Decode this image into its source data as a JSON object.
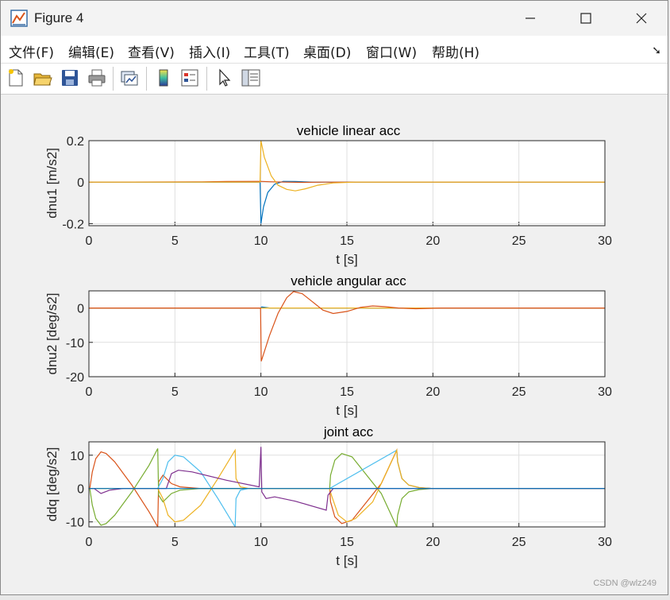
{
  "window": {
    "title": "Figure 4"
  },
  "menu": [
    "文件(F)",
    "编辑(E)",
    "查看(V)",
    "插入(I)",
    "工具(T)",
    "桌面(D)",
    "窗口(W)",
    "帮助(H)"
  ],
  "toolbar_icons": [
    "new-figure-icon",
    "open-file-icon",
    "save-icon",
    "print-icon",
    "link-plot-icon",
    "colorbar-icon",
    "legend-icon",
    "edit-plot-pointer-icon",
    "property-inspector-icon"
  ],
  "watermark": "CSDN @wlz249",
  "colors": {
    "blue": "#0072bd",
    "orange": "#d95319",
    "yellow": "#edb120",
    "purple": "#7e2f8e",
    "green": "#77ac30",
    "cyan": "#4dbeee"
  },
  "chart_data": [
    {
      "type": "line",
      "title": "vehicle linear acc",
      "xlabel": "t [s]",
      "ylabel": "dnu1 [m/s2]",
      "xlim": [
        0,
        30
      ],
      "ylim": [
        -0.21,
        0.2
      ],
      "xticks": [
        "0",
        "5",
        "10",
        "15",
        "20",
        "25",
        "30"
      ],
      "yticks": [
        "-0.2",
        "0",
        "0.2"
      ],
      "grid": true,
      "series": [
        {
          "color": "#0072bd",
          "x": [
            0,
            9.95,
            10.0,
            10.15,
            10.4,
            10.8,
            11.3,
            12.0,
            13.0,
            30
          ],
          "y": [
            0,
            0,
            -0.2,
            -0.12,
            -0.05,
            -0.01,
            0.004,
            0.003,
            0,
            0
          ]
        },
        {
          "color": "#d95319",
          "x": [
            0,
            6.2,
            8.0,
            9.95,
            10.5,
            11.5,
            12.5,
            13.5,
            30
          ],
          "y": [
            0,
            0.001,
            0.003,
            0.004,
            0.002,
            0.0,
            -0.001,
            0,
            0
          ]
        },
        {
          "color": "#edb120",
          "x": [
            0,
            9.95,
            10.0,
            10.2,
            10.6,
            11.0,
            11.5,
            12.0,
            12.6,
            13.3,
            14.2,
            15.5,
            30
          ],
          "y": [
            0,
            0,
            0.2,
            0.12,
            0.03,
            -0.015,
            -0.035,
            -0.042,
            -0.032,
            -0.015,
            -0.004,
            0,
            0
          ]
        }
      ]
    },
    {
      "type": "line",
      "title": "vehicle angular acc",
      "xlabel": "t [s]",
      "ylabel": "dnu2 [deg/s2]",
      "xlim": [
        0,
        30
      ],
      "ylim": [
        -20,
        5
      ],
      "xticks": [
        "0",
        "5",
        "10",
        "15",
        "20",
        "25",
        "30"
      ],
      "yticks": [
        "-20",
        "-10",
        "0"
      ],
      "grid": true,
      "series": [
        {
          "color": "#0072bd",
          "x": [
            0,
            9.98,
            10.05,
            10.5,
            30
          ],
          "y": [
            0,
            0,
            0.3,
            0,
            0
          ]
        },
        {
          "color": "#edb120",
          "x": [
            0,
            30
          ],
          "y": [
            0,
            0
          ]
        },
        {
          "color": "#d95319",
          "x": [
            0,
            9.98,
            10.02,
            10.5,
            11.0,
            11.5,
            11.9,
            12.4,
            13.0,
            13.6,
            14.2,
            15.0,
            15.8,
            16.5,
            17.2,
            18.0,
            19.0,
            20.5,
            30
          ],
          "y": [
            0,
            0,
            -15.5,
            -8.0,
            -1.5,
            3.0,
            4.8,
            4.2,
            1.8,
            -0.6,
            -1.6,
            -1.0,
            0.2,
            0.6,
            0.4,
            0.0,
            -0.2,
            0,
            0
          ]
        }
      ]
    },
    {
      "type": "line",
      "title": "joint acc",
      "xlabel": "t [s]",
      "ylabel": "ddq [deg/s2]",
      "xlim": [
        0,
        30
      ],
      "ylim": [
        -11.5,
        14
      ],
      "xticks": [
        "0",
        "5",
        "10",
        "15",
        "20",
        "25",
        "30"
      ],
      "yticks": [
        "-10",
        "0",
        "10"
      ],
      "grid": true,
      "series": [
        {
          "color": "#d95319",
          "x": [
            0,
            0.05,
            0.2,
            0.4,
            0.7,
            1.0,
            1.5,
            2.5,
            3.5,
            4.0,
            4.05,
            4.3,
            4.8,
            5.3,
            6.5,
            14.0,
            14.05,
            14.3,
            14.7,
            15.3,
            17.0,
            17.9,
            17.95,
            18.2,
            18.6,
            19.2,
            20,
            30
          ],
          "y": [
            0,
            0,
            5.0,
            9.0,
            11.0,
            10.5,
            8.0,
            1.0,
            -7.0,
            -11.5,
            2.0,
            4.0,
            1.5,
            0.5,
            0,
            0,
            -4.0,
            -8.5,
            -10.5,
            -9.5,
            1.5,
            11.5,
            8.0,
            3.0,
            1.0,
            0.3,
            0,
            0
          ]
        },
        {
          "color": "#77ac30",
          "x": [
            0,
            0.05,
            0.2,
            0.4,
            0.7,
            1.0,
            1.5,
            2.5,
            3.5,
            4.0,
            4.05,
            4.3,
            4.8,
            5.3,
            6.5,
            14.0,
            14.05,
            14.3,
            14.7,
            15.3,
            17.0,
            17.9,
            17.95,
            18.2,
            18.6,
            19.2,
            20,
            30
          ],
          "y": [
            0,
            0,
            -5.0,
            -9.0,
            -11.0,
            -10.5,
            -8.0,
            -1.0,
            7.0,
            12.0,
            -2.0,
            -4.0,
            -1.5,
            -0.5,
            0,
            0,
            4.0,
            8.5,
            10.5,
            9.5,
            -1.5,
            -11.5,
            -8.0,
            -3.0,
            -1.0,
            -0.3,
            0,
            0
          ]
        },
        {
          "color": "#4dbeee",
          "x": [
            0,
            0.3,
            1.0,
            2.0,
            4.0,
            4.3,
            4.6,
            5.0,
            5.5,
            6.5,
            7.5,
            8.5,
            8.55,
            8.8,
            9.3,
            10.0,
            14.0,
            17.9,
            17.95,
            18.2,
            18.6,
            19.3,
            20,
            30
          ],
          "y": [
            0,
            0,
            0,
            0,
            0,
            3.0,
            8.0,
            10.0,
            9.5,
            5.0,
            -3.0,
            -11.5,
            -3.0,
            -0.5,
            0,
            0,
            0,
            11.5,
            8.0,
            3.0,
            1.0,
            0.2,
            0,
            0
          ]
        },
        {
          "color": "#edb120",
          "x": [
            0,
            4.0,
            4.3,
            4.6,
            5.0,
            5.5,
            6.5,
            7.5,
            8.5,
            8.55,
            8.8,
            9.3,
            10.0,
            14.0,
            14.1,
            14.5,
            15.0,
            15.5,
            16.5,
            17.9,
            17.95,
            18.2,
            18.6,
            19.3,
            20,
            30
          ],
          "y": [
            0,
            0,
            -3.0,
            -8.0,
            -10.0,
            -9.5,
            -5.0,
            3.0,
            11.5,
            3.0,
            0.5,
            0,
            0,
            0,
            -2.0,
            -8.0,
            -10.0,
            -9.0,
            -4.0,
            11.5,
            8.0,
            3.0,
            1.0,
            0.2,
            0,
            0
          ]
        },
        {
          "color": "#7e2f8e",
          "x": [
            0,
            0.3,
            0.7,
            1.2,
            2.0,
            4.5,
            4.8,
            5.2,
            6.0,
            8.0,
            9.9,
            10.0,
            10.05,
            10.3,
            10.8,
            12.0,
            13.8,
            13.9,
            14.2,
            15.0,
            17.0,
            19.0,
            30
          ],
          "y": [
            0,
            0,
            -1.5,
            -0.5,
            0,
            0,
            4.5,
            5.5,
            5.0,
            2.5,
            0.5,
            12.5,
            -1.0,
            -3.0,
            -2.5,
            -3.8,
            -6.5,
            -2.0,
            0,
            0,
            0,
            0,
            0
          ]
        },
        {
          "color": "#0072bd",
          "x": [
            0,
            30
          ],
          "y": [
            0,
            0
          ]
        }
      ]
    }
  ]
}
